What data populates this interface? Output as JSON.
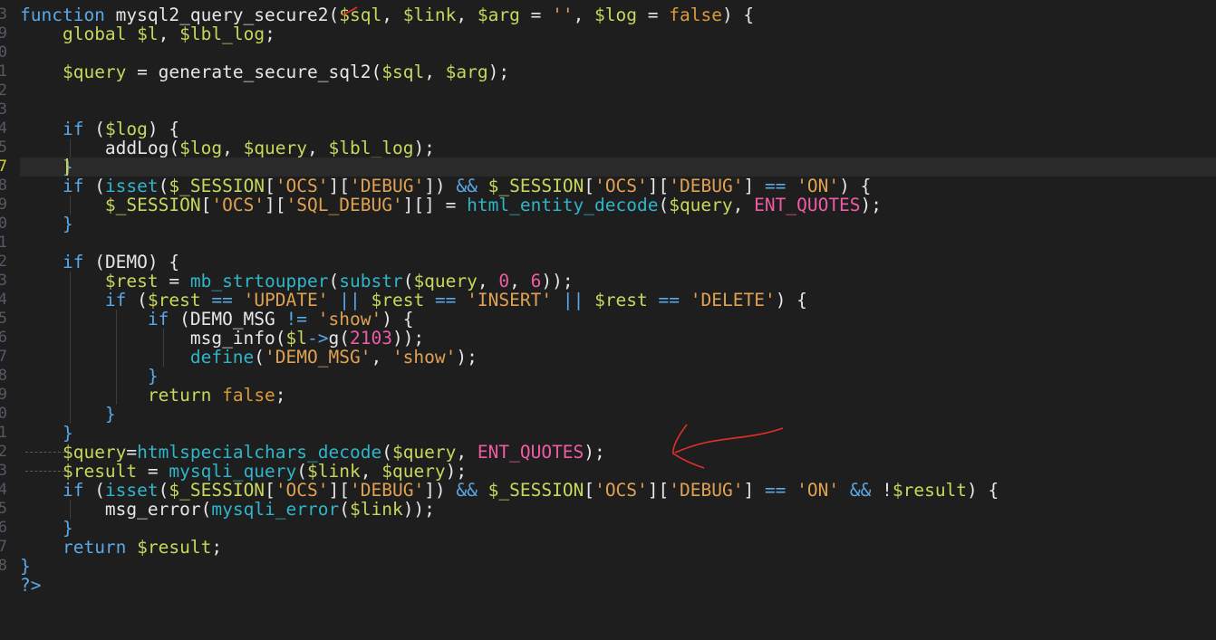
{
  "editor": {
    "line_numbers": [
      "3",
      "9",
      "0",
      "1",
      "2",
      "3",
      "4",
      "5",
      "7",
      "8",
      "9",
      "0",
      "1",
      "2",
      "3",
      "4",
      "5",
      "6",
      "7",
      "8",
      "9",
      "0",
      "1",
      "2",
      "3",
      "4",
      "5",
      "6",
      "7",
      "8"
    ],
    "active_line_index": 8,
    "lines": [
      [
        [
          "kw",
          "function "
        ],
        [
          "ident",
          "mysql2_query_secure2"
        ],
        [
          "punc",
          "("
        ],
        [
          "var",
          "$sql"
        ],
        [
          "punc",
          ", "
        ],
        [
          "var",
          "$link"
        ],
        [
          "punc",
          ", "
        ],
        [
          "var",
          "$arg"
        ],
        [
          "punc",
          " = "
        ],
        [
          "str",
          "''"
        ],
        [
          "punc",
          ", "
        ],
        [
          "var",
          "$log"
        ],
        [
          "punc",
          " = "
        ],
        [
          "bool",
          "false"
        ],
        [
          "punc",
          ") {"
        ]
      ],
      [
        [
          "punc",
          "    "
        ],
        [
          "var",
          "global"
        ],
        [
          "punc",
          " "
        ],
        [
          "var",
          "$l"
        ],
        [
          "punc",
          ", "
        ],
        [
          "var",
          "$lbl_log"
        ],
        [
          "punc",
          ";"
        ]
      ],
      [],
      [
        [
          "punc",
          "    "
        ],
        [
          "var",
          "$query"
        ],
        [
          "punc",
          " = "
        ],
        [
          "ident",
          "generate_secure_sql2"
        ],
        [
          "punc",
          "("
        ],
        [
          "var",
          "$sql"
        ],
        [
          "punc",
          ", "
        ],
        [
          "var",
          "$arg"
        ],
        [
          "punc",
          ");"
        ]
      ],
      [],
      [],
      [
        [
          "punc",
          "    "
        ],
        [
          "kw",
          "if"
        ],
        [
          "punc",
          " ("
        ],
        [
          "var",
          "$log"
        ],
        [
          "punc",
          ") {"
        ]
      ],
      [
        [
          "punc",
          "        "
        ],
        [
          "ident",
          "addLog"
        ],
        [
          "punc",
          "("
        ],
        [
          "var",
          "$log"
        ],
        [
          "punc",
          ", "
        ],
        [
          "var",
          "$query"
        ],
        [
          "punc",
          ", "
        ],
        [
          "var",
          "$lbl_log"
        ],
        [
          "punc",
          ");"
        ]
      ],
      [
        [
          "punc",
          "    "
        ],
        [
          "kw",
          "}"
        ]
      ],
      [
        [
          "punc",
          "    "
        ],
        [
          "kw",
          "if"
        ],
        [
          "punc",
          " ("
        ],
        [
          "fn",
          "isset"
        ],
        [
          "punc",
          "("
        ],
        [
          "var",
          "$_SESSION"
        ],
        [
          "punc",
          "["
        ],
        [
          "str",
          "'OCS'"
        ],
        [
          "punc",
          "]["
        ],
        [
          "str",
          "'DEBUG'"
        ],
        [
          "punc",
          "]) "
        ],
        [
          "kw",
          "&&"
        ],
        [
          "punc",
          " "
        ],
        [
          "var",
          "$_SESSION"
        ],
        [
          "punc",
          "["
        ],
        [
          "str",
          "'OCS'"
        ],
        [
          "punc",
          "]["
        ],
        [
          "str",
          "'DEBUG'"
        ],
        [
          "punc",
          "] "
        ],
        [
          "kw",
          "=="
        ],
        [
          "punc",
          " "
        ],
        [
          "str",
          "'ON'"
        ],
        [
          "punc",
          ") {"
        ]
      ],
      [
        [
          "punc",
          "        "
        ],
        [
          "var",
          "$_SESSION"
        ],
        [
          "punc",
          "["
        ],
        [
          "str",
          "'OCS'"
        ],
        [
          "punc",
          "]["
        ],
        [
          "str",
          "'SQL_DEBUG'"
        ],
        [
          "punc",
          "][] = "
        ],
        [
          "fn",
          "html_entity_decode"
        ],
        [
          "punc",
          "("
        ],
        [
          "var",
          "$query"
        ],
        [
          "punc",
          ", "
        ],
        [
          "const",
          "ENT_QUOTES"
        ],
        [
          "punc",
          ");"
        ]
      ],
      [
        [
          "punc",
          "    "
        ],
        [
          "kw",
          "}"
        ]
      ],
      [],
      [
        [
          "punc",
          "    "
        ],
        [
          "kw",
          "if"
        ],
        [
          "punc",
          " ("
        ],
        [
          "ident",
          "DEMO"
        ],
        [
          "punc",
          ") {"
        ]
      ],
      [
        [
          "punc",
          "        "
        ],
        [
          "var",
          "$rest"
        ],
        [
          "punc",
          " = "
        ],
        [
          "fn",
          "mb_strtoupper"
        ],
        [
          "punc",
          "("
        ],
        [
          "fn",
          "substr"
        ],
        [
          "punc",
          "("
        ],
        [
          "var",
          "$query"
        ],
        [
          "punc",
          ", "
        ],
        [
          "const",
          "0"
        ],
        [
          "punc",
          ", "
        ],
        [
          "const",
          "6"
        ],
        [
          "punc",
          "));"
        ]
      ],
      [
        [
          "punc",
          "        "
        ],
        [
          "kw",
          "if"
        ],
        [
          "punc",
          " ("
        ],
        [
          "var",
          "$rest"
        ],
        [
          "punc",
          " "
        ],
        [
          "kw",
          "=="
        ],
        [
          "punc",
          " "
        ],
        [
          "str",
          "'UPDATE'"
        ],
        [
          "punc",
          " "
        ],
        [
          "kw",
          "||"
        ],
        [
          "punc",
          " "
        ],
        [
          "var",
          "$rest"
        ],
        [
          "punc",
          " "
        ],
        [
          "kw",
          "=="
        ],
        [
          "punc",
          " "
        ],
        [
          "str",
          "'INSERT'"
        ],
        [
          "punc",
          " "
        ],
        [
          "kw",
          "||"
        ],
        [
          "punc",
          " "
        ],
        [
          "var",
          "$rest"
        ],
        [
          "punc",
          " "
        ],
        [
          "kw",
          "=="
        ],
        [
          "punc",
          " "
        ],
        [
          "str",
          "'DELETE'"
        ],
        [
          "punc",
          ") {"
        ]
      ],
      [
        [
          "punc",
          "            "
        ],
        [
          "kw",
          "if"
        ],
        [
          "punc",
          " ("
        ],
        [
          "ident",
          "DEMO_MSG"
        ],
        [
          "punc",
          " "
        ],
        [
          "kw",
          "!="
        ],
        [
          "punc",
          " "
        ],
        [
          "str",
          "'show'"
        ],
        [
          "punc",
          ") {"
        ]
      ],
      [
        [
          "punc",
          "                "
        ],
        [
          "ident",
          "msg_info"
        ],
        [
          "punc",
          "("
        ],
        [
          "var",
          "$l"
        ],
        [
          "kw",
          "->"
        ],
        [
          "ident",
          "g"
        ],
        [
          "punc",
          "("
        ],
        [
          "const",
          "2103"
        ],
        [
          "punc",
          "));"
        ]
      ],
      [
        [
          "punc",
          "                "
        ],
        [
          "fn",
          "define"
        ],
        [
          "punc",
          "("
        ],
        [
          "str",
          "'DEMO_MSG'"
        ],
        [
          "punc",
          ", "
        ],
        [
          "str",
          "'show'"
        ],
        [
          "punc",
          ");"
        ]
      ],
      [
        [
          "punc",
          "            "
        ],
        [
          "kw",
          "}"
        ]
      ],
      [
        [
          "punc",
          "            "
        ],
        [
          "var",
          "return"
        ],
        [
          "punc",
          " "
        ],
        [
          "bool",
          "false"
        ],
        [
          "punc",
          ";"
        ]
      ],
      [
        [
          "punc",
          "        "
        ],
        [
          "kw",
          "}"
        ]
      ],
      [
        [
          "punc",
          "    "
        ],
        [
          "kw",
          "}"
        ]
      ],
      [
        [
          "punc",
          "    "
        ],
        [
          "var",
          "$query"
        ],
        [
          "punc",
          "="
        ],
        [
          "fn",
          "htmlspecialchars_decode"
        ],
        [
          "punc",
          "("
        ],
        [
          "var",
          "$query"
        ],
        [
          "punc",
          ", "
        ],
        [
          "const",
          "ENT_QUOTES"
        ],
        [
          "punc",
          ");"
        ]
      ],
      [
        [
          "punc",
          "    "
        ],
        [
          "var",
          "$result"
        ],
        [
          "punc",
          " = "
        ],
        [
          "fn",
          "mysqli_query"
        ],
        [
          "punc",
          "("
        ],
        [
          "var",
          "$link"
        ],
        [
          "punc",
          ", "
        ],
        [
          "var",
          "$query"
        ],
        [
          "punc",
          ");"
        ]
      ],
      [
        [
          "punc",
          "    "
        ],
        [
          "kw",
          "if"
        ],
        [
          "punc",
          " ("
        ],
        [
          "fn",
          "isset"
        ],
        [
          "punc",
          "("
        ],
        [
          "var",
          "$_SESSION"
        ],
        [
          "punc",
          "["
        ],
        [
          "str",
          "'OCS'"
        ],
        [
          "punc",
          "]["
        ],
        [
          "str",
          "'DEBUG'"
        ],
        [
          "punc",
          "]) "
        ],
        [
          "kw",
          "&&"
        ],
        [
          "punc",
          " "
        ],
        [
          "var",
          "$_SESSION"
        ],
        [
          "punc",
          "["
        ],
        [
          "str",
          "'OCS'"
        ],
        [
          "punc",
          "]["
        ],
        [
          "str",
          "'DEBUG'"
        ],
        [
          "punc",
          "] "
        ],
        [
          "kw",
          "=="
        ],
        [
          "punc",
          " "
        ],
        [
          "str",
          "'ON'"
        ],
        [
          "punc",
          " "
        ],
        [
          "kw",
          "&&"
        ],
        [
          "punc",
          " !"
        ],
        [
          "var",
          "$result"
        ],
        [
          "punc",
          ") {"
        ]
      ],
      [
        [
          "punc",
          "        "
        ],
        [
          "ident",
          "msg_error"
        ],
        [
          "punc",
          "("
        ],
        [
          "fn",
          "mysqli_error"
        ],
        [
          "punc",
          "("
        ],
        [
          "var",
          "$link"
        ],
        [
          "punc",
          "));"
        ]
      ],
      [
        [
          "punc",
          "    "
        ],
        [
          "kw",
          "}"
        ]
      ],
      [
        [
          "punc",
          "    "
        ],
        [
          "kw",
          "return"
        ],
        [
          "punc",
          " "
        ],
        [
          "var",
          "$result"
        ],
        [
          "punc",
          ";"
        ]
      ],
      [
        [
          "kw",
          "}"
        ]
      ],
      [
        [
          "kw",
          "?>"
        ]
      ]
    ]
  },
  "colors": {
    "background": "#1e1e1e",
    "keyword": "#59a8e8",
    "variable": "#c9d65c",
    "function": "#2fb5c8",
    "string": "#e0a252",
    "constant": "#f05ba6",
    "annotation": "#e0302a"
  }
}
